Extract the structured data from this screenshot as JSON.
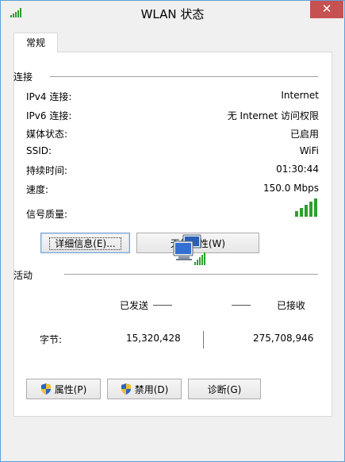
{
  "window": {
    "title": "WLAN 状态",
    "close_label": "✕"
  },
  "tabs": [
    {
      "label": "常规"
    }
  ],
  "connection": {
    "group_label": "连接",
    "rows": [
      {
        "label": "IPv4 连接:",
        "value": "Internet"
      },
      {
        "label": "IPv6 连接:",
        "value": "无 Internet 访问权限"
      },
      {
        "label": "媒体状态:",
        "value": "已启用"
      },
      {
        "label": "SSID:",
        "value": "WiFi"
      },
      {
        "label": "持续时间:",
        "value": "01:30:44"
      },
      {
        "label": "速度:",
        "value": "150.0 Mbps"
      }
    ],
    "signal_label": "信号质量:",
    "signal_bars_filled": 5,
    "signal_bars_total": 5,
    "details_button": "详细信息(E)...",
    "wireless_props_button": "无线属性(W)"
  },
  "activity": {
    "group_label": "活动",
    "sent_label": "已发送",
    "received_label": "已接收",
    "bytes_label": "字节:",
    "bytes_sent": "15,320,428",
    "bytes_received": "275,708,946"
  },
  "footer": {
    "properties_button": "属性(P)",
    "disable_button": "禁用(D)",
    "diagnose_button": "诊断(G)"
  },
  "icons": {
    "title": "wifi-signal-icon",
    "signal": "signal-quality-icon",
    "network": "network-computers-icon",
    "shield": "uac-shield-icon"
  },
  "colors": {
    "signal_green": "#2f9e2f",
    "close_red": "#c75050",
    "window_border": "#5fa0d8"
  }
}
